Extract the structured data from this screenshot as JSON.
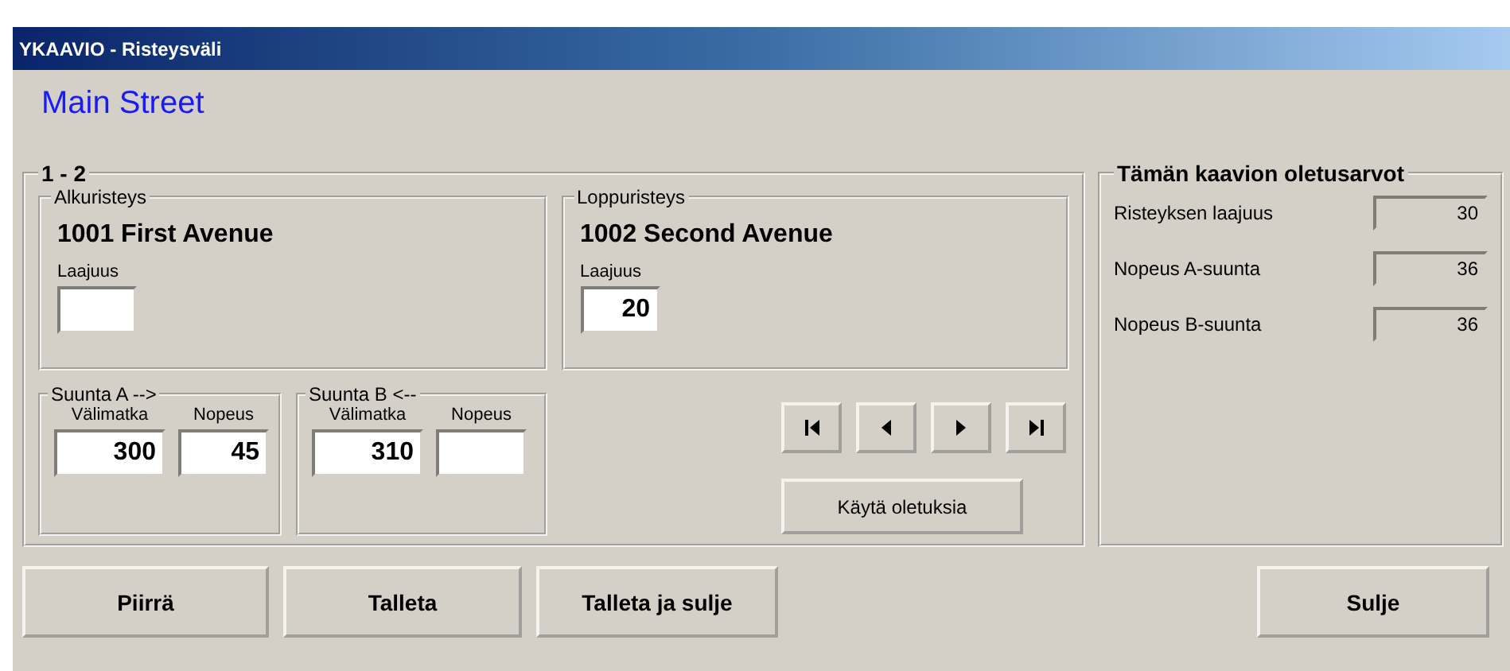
{
  "window": {
    "title": "YKAAVIO - Risteysväli"
  },
  "street": "Main Street",
  "section": {
    "title": "1 - 2",
    "intersections": [
      {
        "legend": "Alkuristeys",
        "name": "1001 First Avenue",
        "field": {
          "label": "Laajuus"
        }
      },
      {
        "legend": "Loppuristeys",
        "name": "1002 Second Avenue",
        "field": {
          "label": "Laajuus",
          "value": "20"
        }
      }
    ],
    "directions": [
      {
        "legend": "Suunta A  -->",
        "fields": [
          {
            "label": "Välimatka",
            "value": "300"
          },
          {
            "label": "Nopeus",
            "value": "45"
          }
        ]
      },
      {
        "legend": "Suunta B  <--",
        "fields": [
          {
            "label": "Välimatka",
            "value": "310"
          },
          {
            "label": "Nopeus"
          }
        ]
      }
    ],
    "navigation": [
      {
        "kind": "first"
      },
      {
        "kind": "prev"
      },
      {
        "kind": "next"
      },
      {
        "kind": "last"
      }
    ],
    "defaults_button": "Käytä oletuksia"
  },
  "defaults": {
    "title": "Tämän kaavion oletusarvot",
    "rows": [
      {
        "label": "Risteyksen laajuus",
        "value": "30"
      },
      {
        "label": "Nopeus A-suunta",
        "value": "36"
      },
      {
        "label": "Nopeus B-suunta",
        "value": "36"
      }
    ]
  },
  "buttons": [
    {
      "label": "Piirrä",
      "kind": "left"
    },
    {
      "label": "Talleta",
      "kind": "left"
    },
    {
      "label": "Talleta ja sulje",
      "kind": "left"
    },
    {
      "label": "Sulje",
      "kind": "right"
    }
  ]
}
